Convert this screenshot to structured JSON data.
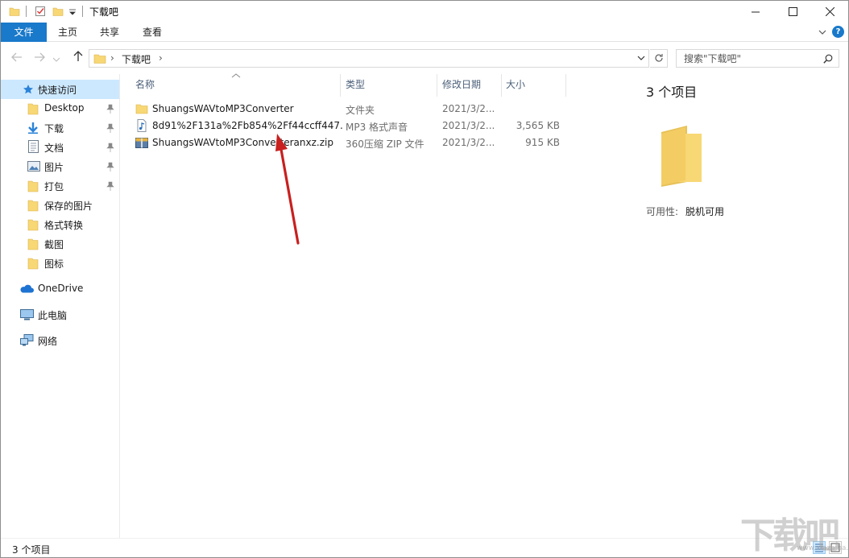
{
  "window": {
    "title": "下载吧",
    "controls": {
      "minimize": "—",
      "maximize": "☐",
      "close": "✕"
    }
  },
  "ribbon": {
    "tabs": [
      "文件",
      "主页",
      "共享",
      "查看"
    ]
  },
  "address": {
    "path": [
      "下载吧"
    ],
    "search_placeholder": "搜索\"下载吧\""
  },
  "sidebar": {
    "quick_access": "快速访问",
    "items": [
      {
        "label": "Desktop",
        "icon": "folder-icon",
        "pinned": true
      },
      {
        "label": "下载",
        "icon": "download-icon",
        "pinned": true
      },
      {
        "label": "文档",
        "icon": "document-icon",
        "pinned": true
      },
      {
        "label": "图片",
        "icon": "picture-icon",
        "pinned": true
      },
      {
        "label": "打包",
        "icon": "folder-icon",
        "pinned": true
      },
      {
        "label": "保存的图片",
        "icon": "folder-icon",
        "pinned": false
      },
      {
        "label": "格式转换",
        "icon": "folder-icon",
        "pinned": false
      },
      {
        "label": "截图",
        "icon": "folder-icon",
        "pinned": false
      },
      {
        "label": "图标",
        "icon": "folder-icon",
        "pinned": false
      }
    ],
    "onedrive": "OneDrive",
    "this_pc": "此电脑",
    "network": "网络"
  },
  "columns": {
    "name": "名称",
    "type": "类型",
    "date": "修改日期",
    "size": "大小"
  },
  "files": [
    {
      "name": "ShuangsWAVtoMP3Converter",
      "type": "文件夹",
      "date": "2021/3/2...",
      "size": "",
      "icon": "folder-icon"
    },
    {
      "name": "8d91%2F131a%2Fb854%2Ff44ccff447...",
      "type": "MP3 格式声音",
      "date": "2021/3/2...",
      "size": "3,565 KB",
      "icon": "audio-file-icon"
    },
    {
      "name": "ShuangsWAVtoMP3Converteranxz.zip",
      "type": "360压缩 ZIP 文件",
      "date": "2021/3/2...",
      "size": "915 KB",
      "icon": "zip-file-icon"
    }
  ],
  "details": {
    "count": "3 个项目",
    "availability_label": "可用性:",
    "availability_value": "脱机可用"
  },
  "status": {
    "count": "3 个项目"
  },
  "colors": {
    "accent": "#1979ca",
    "selection": "#cce8ff",
    "folder": "#f8d775",
    "annotation_arrow": "#c8201f"
  },
  "watermark": {
    "logo_text": "下载吧",
    "url": "www.xiazaiba.com"
  }
}
